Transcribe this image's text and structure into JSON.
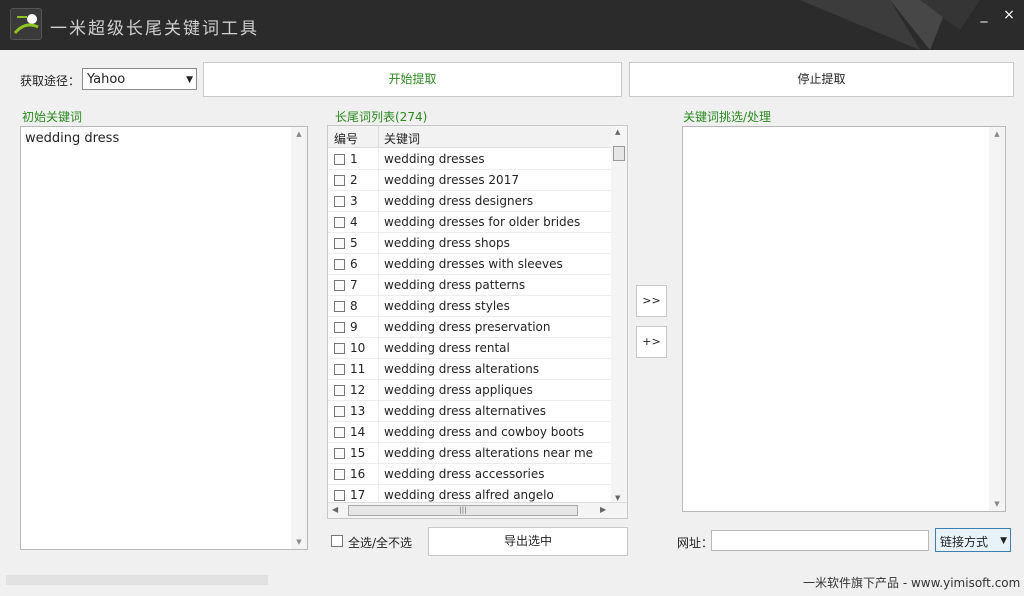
{
  "window": {
    "title": "一米超级长尾关键词工具",
    "minimize_label": "_",
    "close_label": "×"
  },
  "toolbar": {
    "source_label": "获取途径：",
    "source_value": "Yahoo",
    "start_label": "开始提取",
    "stop_label": "停止提取"
  },
  "left_panel": {
    "title": "初始关键词",
    "content": "wedding dress"
  },
  "middle_panel": {
    "title": "长尾词列表(274)",
    "col_num": "编号",
    "col_kw": "关键词",
    "rows": [
      {
        "num": "1",
        "kw": "wedding dresses"
      },
      {
        "num": "2",
        "kw": "wedding dresses 2017"
      },
      {
        "num": "3",
        "kw": "wedding dress designers"
      },
      {
        "num": "4",
        "kw": "wedding dresses for older brides"
      },
      {
        "num": "5",
        "kw": "wedding dress shops"
      },
      {
        "num": "6",
        "kw": "wedding dresses with sleeves"
      },
      {
        "num": "7",
        "kw": "wedding dress patterns"
      },
      {
        "num": "8",
        "kw": "wedding dress styles"
      },
      {
        "num": "9",
        "kw": "wedding dress preservation"
      },
      {
        "num": "10",
        "kw": "wedding dress rental"
      },
      {
        "num": "11",
        "kw": "wedding dress alterations"
      },
      {
        "num": "12",
        "kw": "wedding dress appliques"
      },
      {
        "num": "13",
        "kw": "wedding dress alternatives"
      },
      {
        "num": "14",
        "kw": "wedding dress and cowboy boots"
      },
      {
        "num": "15",
        "kw": "wedding dress alterations near me"
      },
      {
        "num": "16",
        "kw": "wedding dress accessories"
      },
      {
        "num": "17",
        "kw": "wedding dress alfred angelo"
      }
    ],
    "select_all_label": "全选/全不选",
    "export_label": "导出选中"
  },
  "transfer": {
    "move_label": ">>",
    "add_label": "+>"
  },
  "right_panel": {
    "title": "关键词挑选/处理",
    "url_label": "网址：",
    "url_value": "",
    "link_mode_label": "链接方式"
  },
  "footer": {
    "brand": "一米软件旗下产品 - www.yimisoft.com"
  }
}
